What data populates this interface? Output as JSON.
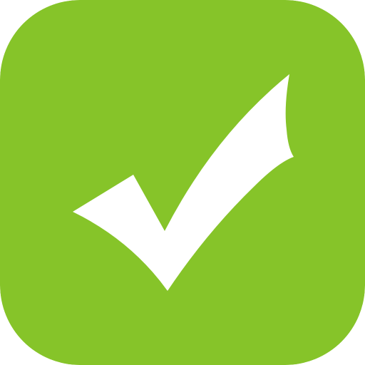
{
  "app_icon": {
    "icon": "checkmark-icon",
    "background_color": "#86c429",
    "checkmark_color": "#ffffff"
  }
}
